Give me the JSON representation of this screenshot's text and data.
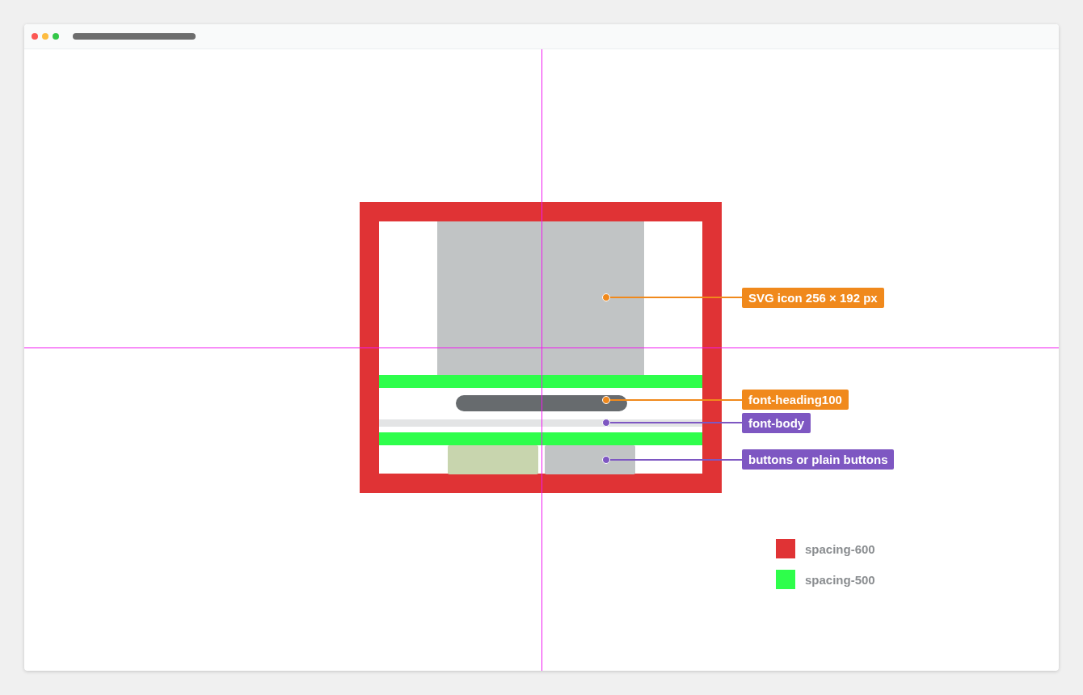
{
  "annotations": [
    {
      "label": "SVG icon 256 × 192 px",
      "color": "#f0891c"
    },
    {
      "label": "font-heading100",
      "color": "#f0891c"
    },
    {
      "label": "font-body",
      "color": "#7e57c2"
    },
    {
      "label": "buttons or plain buttons",
      "color": "#7e57c2"
    }
  ],
  "legend": [
    {
      "label": "spacing-600",
      "color": "#e03335"
    },
    {
      "label": "spacing-500",
      "color": "#2efe4b"
    }
  ]
}
